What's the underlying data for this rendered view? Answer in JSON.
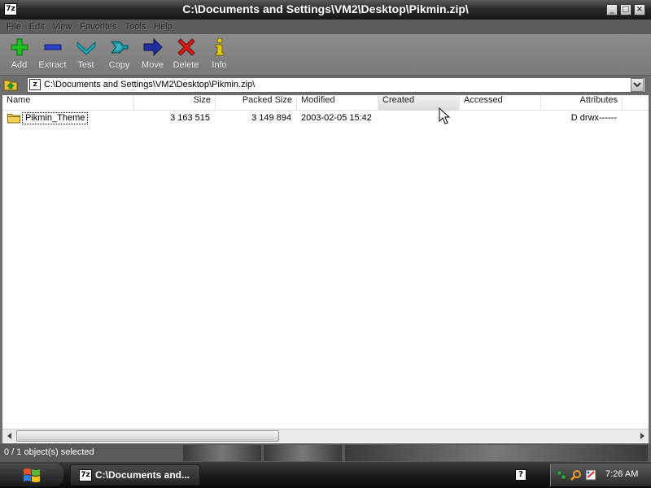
{
  "window": {
    "title": "C:\\Documents and Settings\\VM2\\Desktop\\Pikmin.zip\\",
    "app_icon_text": "7z",
    "controls": [
      "_",
      "□",
      "×"
    ]
  },
  "menu": [
    "File",
    "Edit",
    "View",
    "Favorites",
    "Tools",
    "Help"
  ],
  "toolbar": [
    {
      "label": "Add",
      "icon": "plus-icon",
      "color": "#1fbf1f"
    },
    {
      "label": "Extract",
      "icon": "minus-icon",
      "color": "#2b3fc7"
    },
    {
      "label": "Test",
      "icon": "check-chevron-icon",
      "color": "#22a7b8"
    },
    {
      "label": "Copy",
      "icon": "double-arrow-icon",
      "color": "#1f8fa0"
    },
    {
      "label": "Move",
      "icon": "arrow-right-icon",
      "color": "#1f2f9f"
    },
    {
      "label": "Delete",
      "icon": "x-icon",
      "color": "#d81c1c"
    },
    {
      "label": "Info",
      "icon": "info-icon",
      "color": "#e0c81c"
    }
  ],
  "address": {
    "path": "C:\\Documents and Settings\\VM2\\Desktop\\Pikmin.zip\\",
    "icon_text": "Z"
  },
  "columns": [
    "Name",
    "Size",
    "Packed Size",
    "Modified",
    "Created",
    "Accessed",
    "Attributes"
  ],
  "rows": [
    {
      "name": "Pikmin_Theme",
      "size": "3 163 515",
      "packed_size": "3 149 894",
      "modified": "2003-02-05 15:42",
      "created": "",
      "accessed": "",
      "attributes": "D drwx------"
    }
  ],
  "status": {
    "text": "0 / 1 object(s) selected"
  },
  "taskbar": {
    "task_icon_text": "7z",
    "task_label": "C:\\Documents and...",
    "help_text": "?",
    "clock": "7:26 AM"
  }
}
